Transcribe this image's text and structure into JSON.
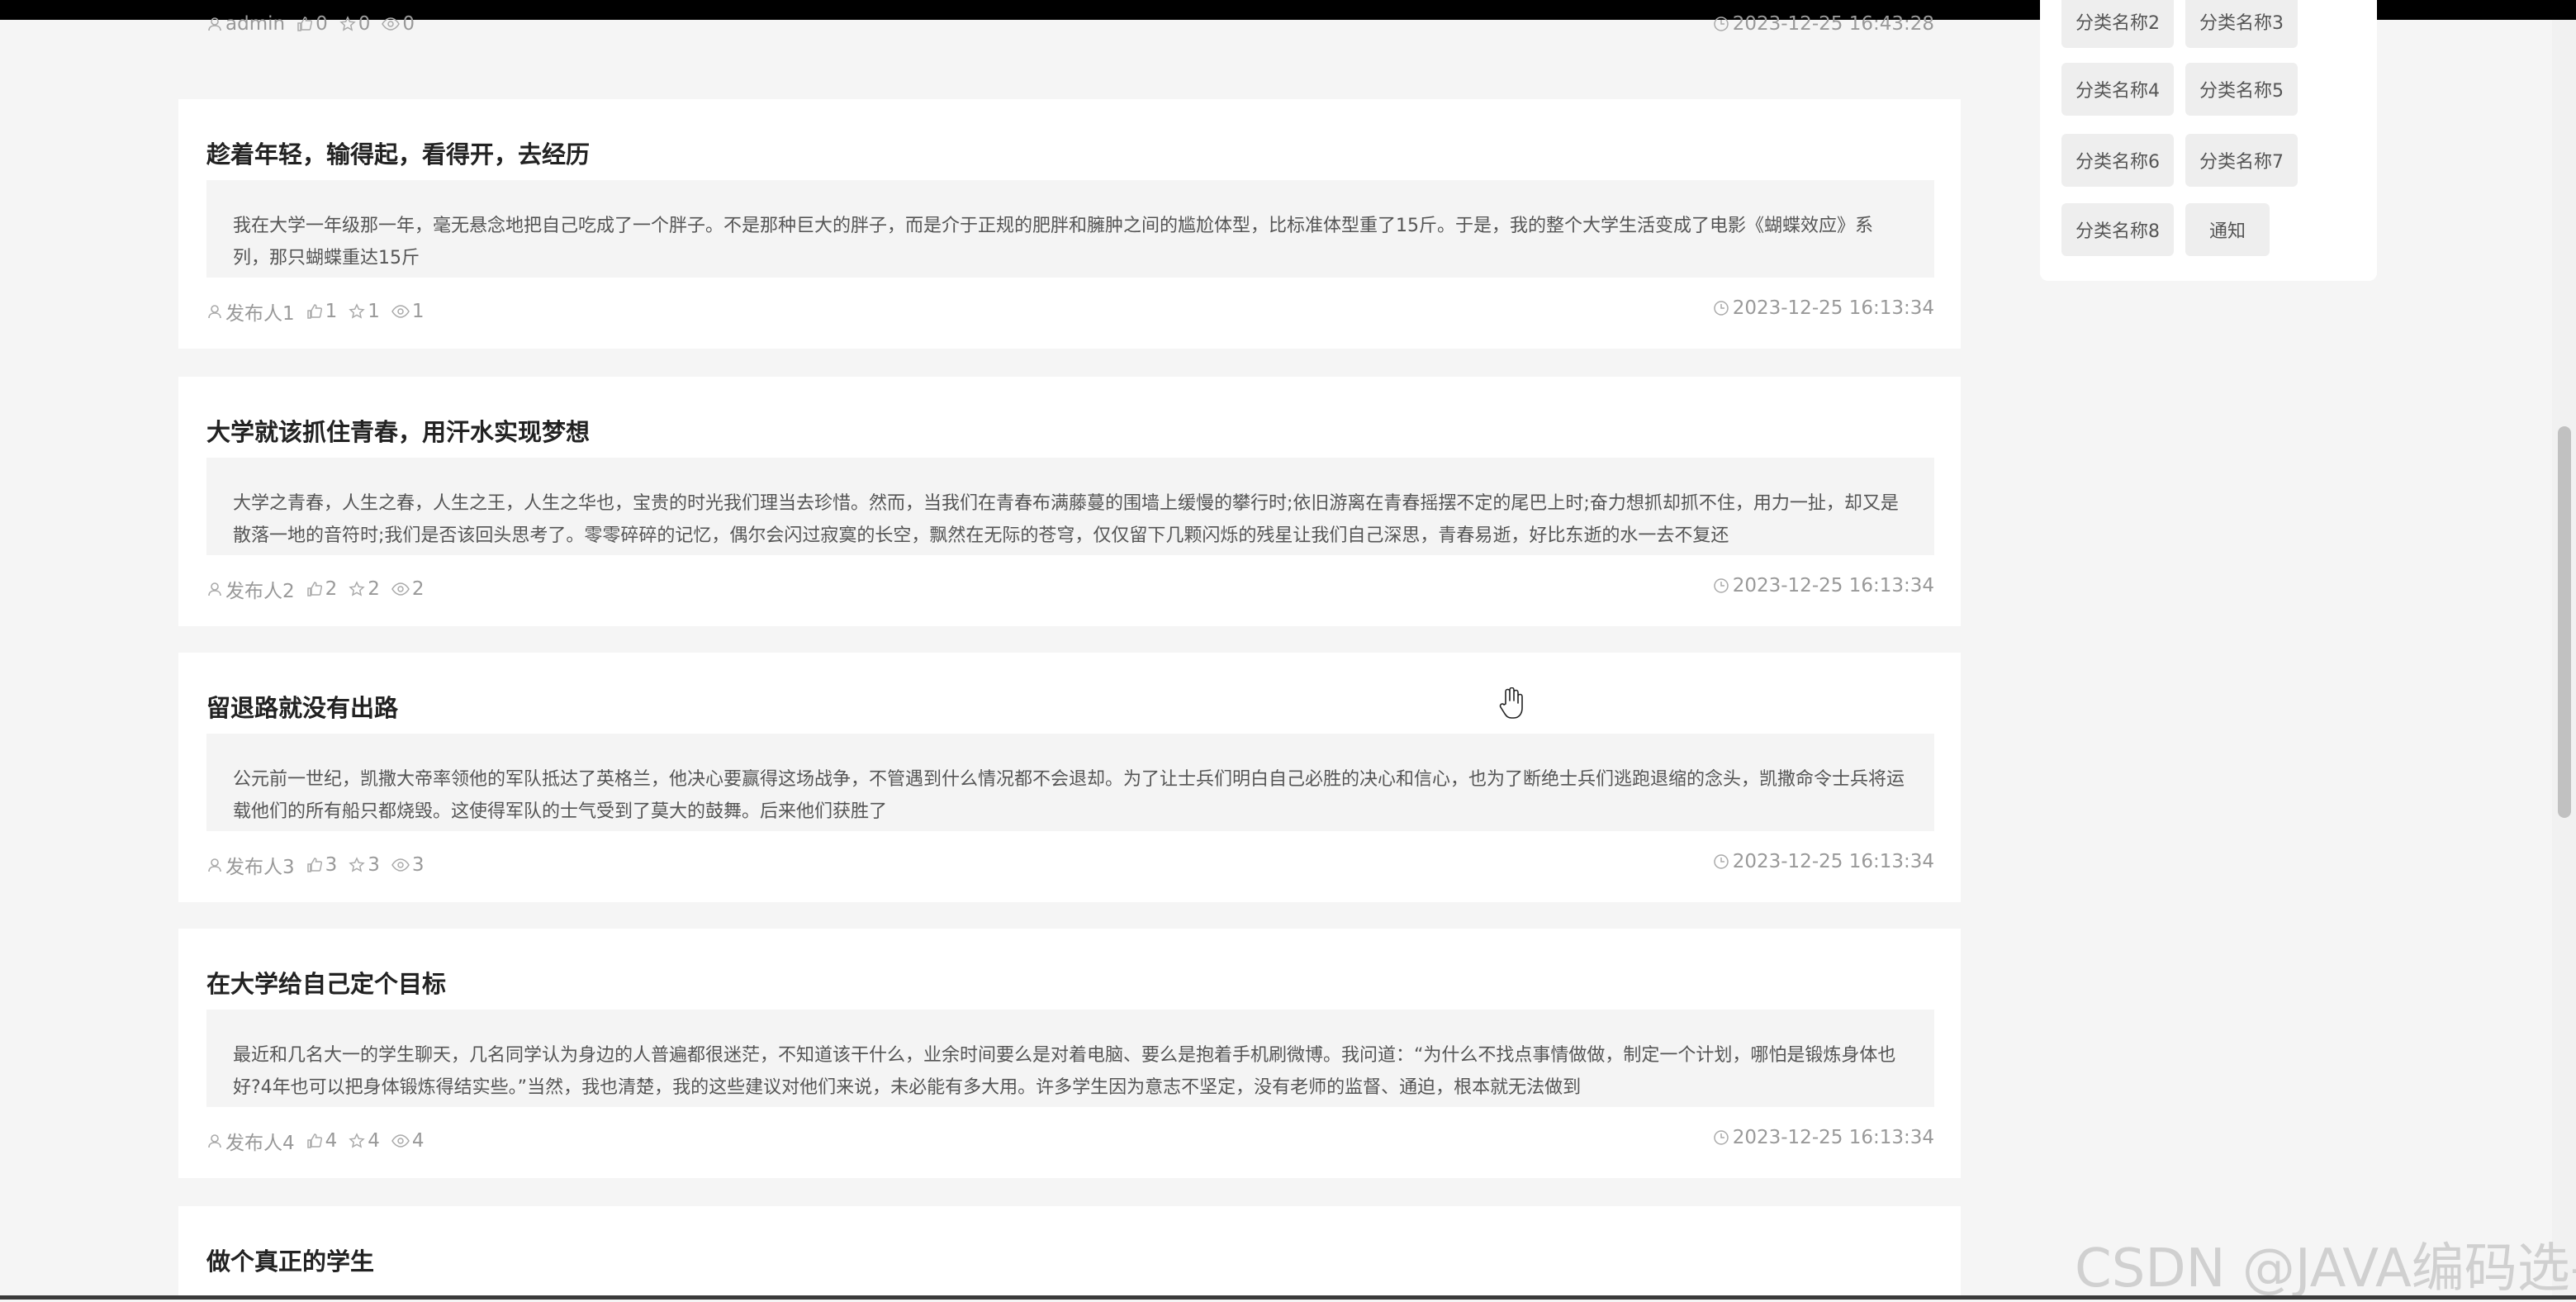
{
  "first_meta": {
    "author": "admin",
    "likes": "0",
    "favorites": "0",
    "views": "0",
    "time": "2023-12-25 16:43:28"
  },
  "posts": [
    {
      "title": "趁着年轻，输得起，看得开，去经历",
      "summary": "我在大学一年级那一年，毫无悬念地把自己吃成了一个胖子。不是那种巨大的胖子，而是介于正规的肥胖和臃肿之间的尴尬体型，比标准体型重了15斤。于是，我的整个大学生活变成了电影《蝴蝶效应》系列，那只蝴蝶重达15斤",
      "author": "发布人1",
      "likes": "1",
      "favorites": "1",
      "views": "1",
      "time": "2023-12-25 16:13:34"
    },
    {
      "title": "大学就该抓住青春，用汗水实现梦想",
      "summary": "大学之青春，人生之春，人生之王，人生之华也，宝贵的时光我们理当去珍惜。然而，当我们在青春布满藤蔓的围墙上缓慢的攀行时;依旧游离在青春摇摆不定的尾巴上时;奋力想抓却抓不住，用力一扯，却又是散落一地的音符时;我们是否该回头思考了。零零碎碎的记忆，偶尔会闪过寂寞的长空，飘然在无际的苍穹，仅仅留下几颗闪烁的残星让我们自己深思，青春易逝，好比东逝的水一去不复还",
      "author": "发布人2",
      "likes": "2",
      "favorites": "2",
      "views": "2",
      "time": "2023-12-25 16:13:34"
    },
    {
      "title": "留退路就没有出路",
      "summary": "公元前一世纪，凯撒大帝率领他的军队抵达了英格兰，他决心要赢得这场战争，不管遇到什么情况都不会退却。为了让士兵们明白自己必胜的决心和信心，也为了断绝士兵们逃跑退缩的念头，凯撒命令士兵将运载他们的所有船只都烧毁。这使得军队的士气受到了莫大的鼓舞。后来他们获胜了",
      "author": "发布人3",
      "likes": "3",
      "favorites": "3",
      "views": "3",
      "time": "2023-12-25 16:13:34"
    },
    {
      "title": "在大学给自己定个目标",
      "summary": "最近和几名大一的学生聊天，几名同学认为身边的人普遍都很迷茫，不知道该干什么，业余时间要么是对着电脑、要么是抱着手机刷微博。我问道：“为什么不找点事情做做，制定一个计划，哪怕是锻炼身体也好?4年也可以把身体锻炼得结实些。”当然，我也清楚，我的这些建议对他们来说，未必能有多大用。许多学生因为意志不坚定，没有老师的监督、通迫，根本就无法做到",
      "author": "发布人4",
      "likes": "4",
      "favorites": "4",
      "views": "4",
      "time": "2023-12-25 16:13:34"
    },
    {
      "title": "做个真正的学生"
    }
  ],
  "categories": [
    "分类名称2",
    "分类名称3",
    "分类名称4",
    "分类名称5",
    "分类名称6",
    "分类名称7",
    "分类名称8",
    "通知"
  ],
  "watermark": "CSDN @JAVA编码选手"
}
